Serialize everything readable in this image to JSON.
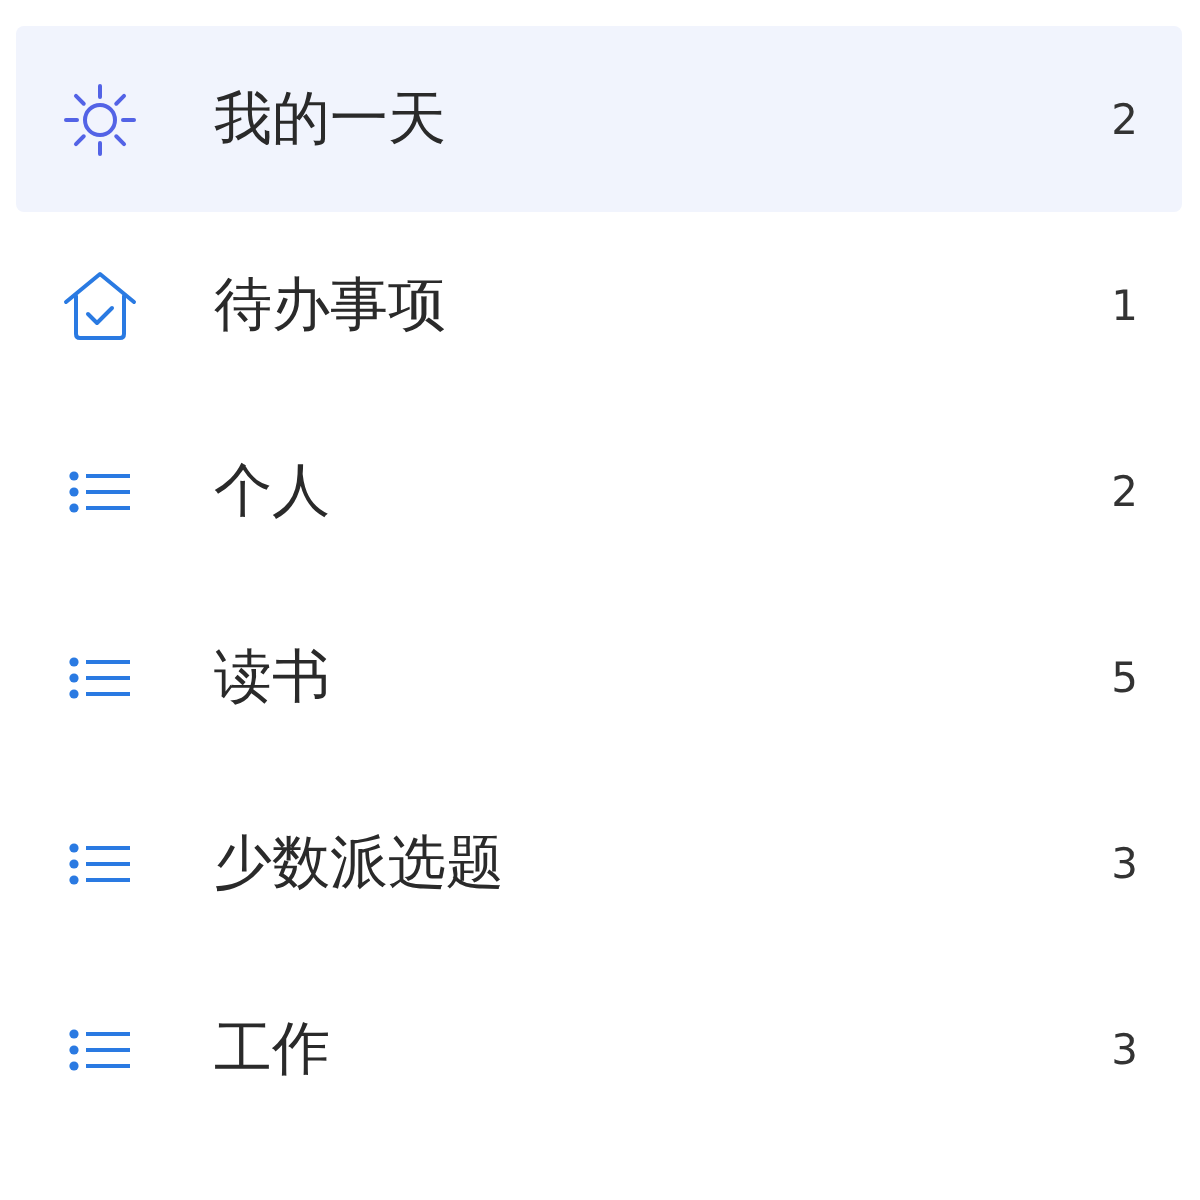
{
  "lists": [
    {
      "kind": "sun",
      "label": "我的一天",
      "count": "2",
      "selected": true
    },
    {
      "kind": "home",
      "label": "待办事项",
      "count": "1",
      "selected": false
    },
    {
      "kind": "list",
      "label": "个人",
      "count": "2",
      "selected": false
    },
    {
      "kind": "list",
      "label": "读书",
      "count": "5",
      "selected": false
    },
    {
      "kind": "list",
      "label": "少数派选题",
      "count": "3",
      "selected": false
    },
    {
      "kind": "list",
      "label": "工作",
      "count": "3",
      "selected": false
    }
  ]
}
